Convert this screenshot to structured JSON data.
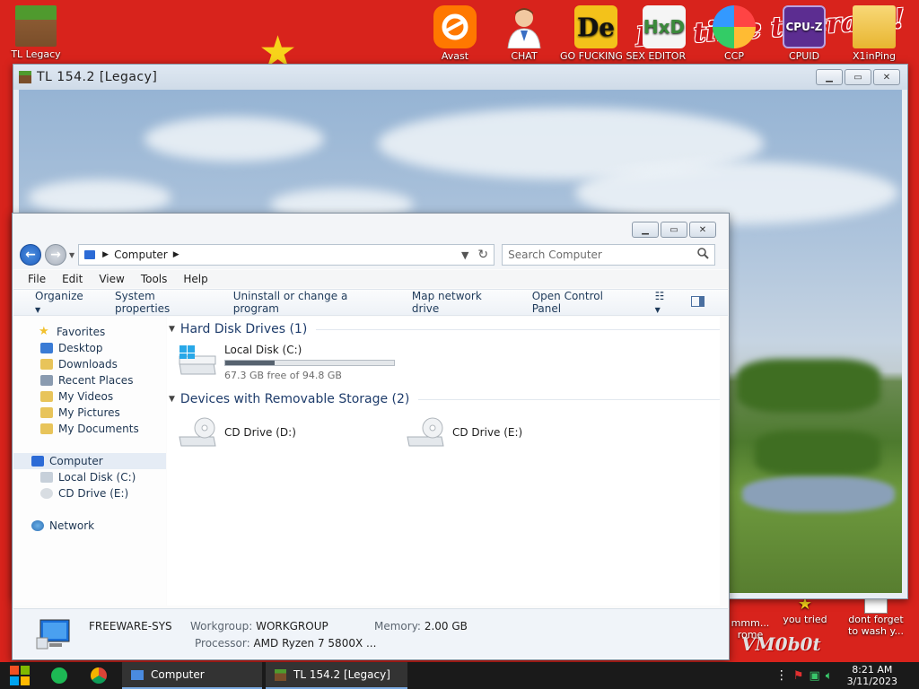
{
  "desktop": {
    "banner_text": "It's time to crash!",
    "icons_top": [
      {
        "label": "TL Legacy",
        "icon": "grass-block-icon"
      },
      {
        "label": "Avast",
        "icon": "avast-icon"
      },
      {
        "label": "CHAT",
        "icon": "doctor-icon"
      },
      {
        "label": "GO FUCKING SEX EDITOR",
        "icon": "de-editor-icon"
      },
      {
        "label": "",
        "icon": "hxd-icon"
      },
      {
        "label": "CCP",
        "icon": "ccp-icon"
      },
      {
        "label": "CPUID",
        "icon": "cpuz-icon"
      },
      {
        "label": "X1inPing",
        "icon": "folder-user-icon"
      }
    ],
    "icons_bottom": [
      {
        "label": "mmm... rome"
      },
      {
        "label": "you tried"
      },
      {
        "label": "dont forget to wash y..."
      }
    ],
    "watermark": "VM0b0t"
  },
  "minecraft_window": {
    "title": "TL 154.2 [Legacy]"
  },
  "explorer": {
    "address": {
      "root_label": "Computer"
    },
    "search_placeholder": "Search Computer",
    "menu": [
      "File",
      "Edit",
      "View",
      "Tools",
      "Help"
    ],
    "commands": {
      "organize": "Organize",
      "system_properties": "System properties",
      "uninstall": "Uninstall or change a program",
      "map_network": "Map network drive",
      "control_panel": "Open Control Panel"
    },
    "nav": {
      "favorites": "Favorites",
      "fav_items": [
        "Desktop",
        "Downloads",
        "Recent Places",
        "My Videos",
        "My Pictures",
        "My Documents"
      ],
      "computer": "Computer",
      "computer_items": [
        "Local Disk (C:)",
        "CD Drive (E:)"
      ],
      "network": "Network"
    },
    "groups": {
      "hard_disks": "Hard Disk Drives (1)",
      "removable": "Devices with Removable Storage (2)"
    },
    "drives": {
      "c": {
        "name": "Local Disk (C:)",
        "free": "67.3 GB free of 94.8 GB",
        "used_fraction": 0.29
      },
      "d": {
        "name": "CD Drive (D:)"
      },
      "e": {
        "name": "CD Drive (E:)"
      }
    },
    "details": {
      "computer_name": "FREEWARE-SYS",
      "workgroup_label": "Workgroup:",
      "workgroup_value": "WORKGROUP",
      "memory_label": "Memory:",
      "memory_value": "2.00 GB",
      "processor_label": "Processor:",
      "processor_value": "AMD Ryzen 7 5800X ..."
    }
  },
  "taskbar": {
    "tasks": [
      {
        "label": "Computer"
      },
      {
        "label": "TL 154.2 [Legacy]"
      }
    ],
    "time": "8:21 AM",
    "date": "3/11/2023"
  },
  "colors": {
    "desktop_bg": "#d8231c",
    "accent": "#1f5fbf"
  }
}
